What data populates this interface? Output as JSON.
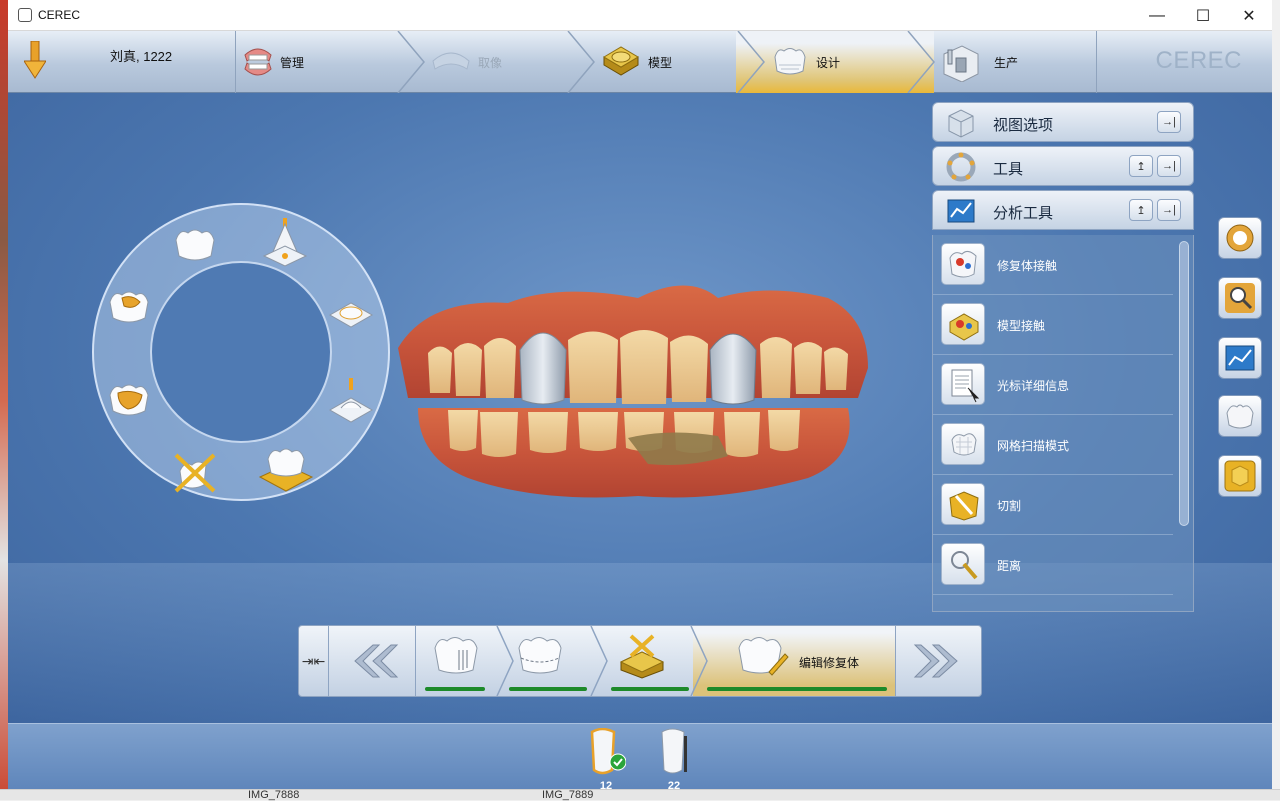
{
  "window": {
    "title": "CEREC"
  },
  "window_controls": {
    "minimize": "—",
    "maximize": "☐",
    "close": "✕"
  },
  "workflow": {
    "patient": "刘真, 1222",
    "steps": [
      {
        "label": "管理",
        "state": "normal"
      },
      {
        "label": "取像",
        "state": "disabled"
      },
      {
        "label": "模型",
        "state": "normal"
      },
      {
        "label": "设计",
        "state": "active"
      },
      {
        "label": "生产",
        "state": "normal"
      }
    ],
    "brand": "CEREC"
  },
  "panels": {
    "view_options": {
      "title": "视图选项"
    },
    "tools": {
      "title": "工具"
    },
    "analysis": {
      "title": "分析工具"
    }
  },
  "analysis_tools": [
    {
      "label": "修复体接触"
    },
    {
      "label": "模型接触"
    },
    {
      "label": "光标详细信息"
    },
    {
      "label": "网格扫描模式"
    },
    {
      "label": "切割"
    },
    {
      "label": "距离"
    }
  ],
  "design_steps": {
    "collapse": "⇥⇤",
    "active_label": "编辑修复体"
  },
  "teeth": [
    {
      "number": "12",
      "selected": true
    },
    {
      "number": "22",
      "selected": false
    }
  ],
  "filmstrip": {
    "left": "IMG_7888",
    "right": "IMG_7889"
  },
  "colors": {
    "accent_gold": "#e9b83a",
    "progress_green": "#1d8a2a",
    "background_blue": "#4c77b0"
  }
}
